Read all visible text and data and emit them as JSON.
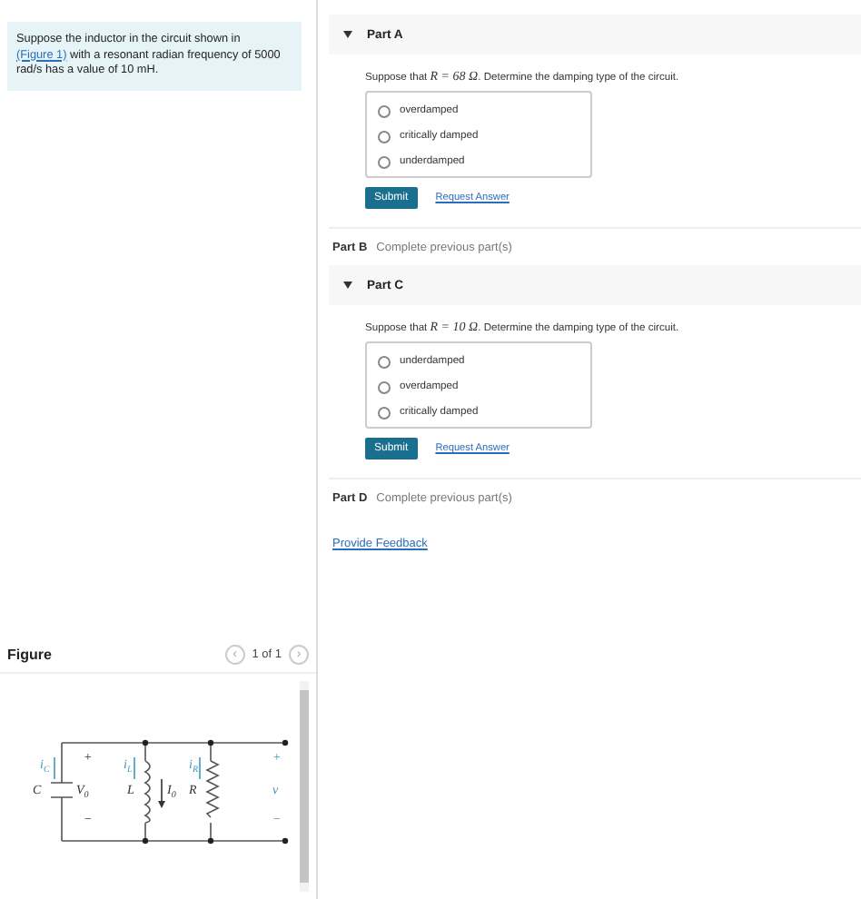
{
  "intro": {
    "before": "Suppose the inductor in the circuit shown in ",
    "link": "(Figure 1)",
    "after": " with a resonant radian frequency of 5000 rad/s has a value of 10 mH."
  },
  "figure": {
    "title": "Figure",
    "prev": "‹",
    "pager": "1 of 1",
    "next": "›",
    "labels": [
      {
        "main": "i",
        "sub": "C"
      },
      {
        "main": "+"
      },
      {
        "main": "C"
      },
      {
        "main": "V",
        "sub": "0"
      },
      {
        "main": "−"
      },
      {
        "main": "i",
        "sub": "L"
      },
      {
        "main": "L"
      },
      {
        "main": "I",
        "sub": "0"
      },
      {
        "main": "i",
        "sub": "R"
      },
      {
        "main": "R"
      },
      {
        "main": "+"
      },
      {
        "main": "v"
      },
      {
        "main": "−"
      }
    ]
  },
  "parts": [
    {
      "kind": "open",
      "label": "Part A",
      "question_before": "Suppose that ",
      "math": "R = 68 Ω",
      "question_after": ". Determine the damping type of the circuit.",
      "options": [
        {
          "label": "overdamped",
          "selected": false
        },
        {
          "label": "critically damped",
          "selected": false
        },
        {
          "label": "underdamped",
          "selected": false
        }
      ],
      "submit": "Submit",
      "request": "Request Answer"
    },
    {
      "kind": "locked",
      "label": "Part B",
      "note": "Complete previous part(s)"
    },
    {
      "kind": "open",
      "label": "Part C",
      "question_before": "Suppose that ",
      "math": "R = 10 Ω",
      "question_after": ". Determine the damping type of the circuit.",
      "options": [
        {
          "label": "underdamped",
          "selected": false
        },
        {
          "label": "overdamped",
          "selected": false
        },
        {
          "label": "critically damped",
          "selected": false
        }
      ],
      "submit": "Submit",
      "request": "Request Answer"
    },
    {
      "kind": "locked",
      "label": "Part D",
      "note": "Complete previous part(s)"
    }
  ],
  "feedback": "Provide Feedback"
}
